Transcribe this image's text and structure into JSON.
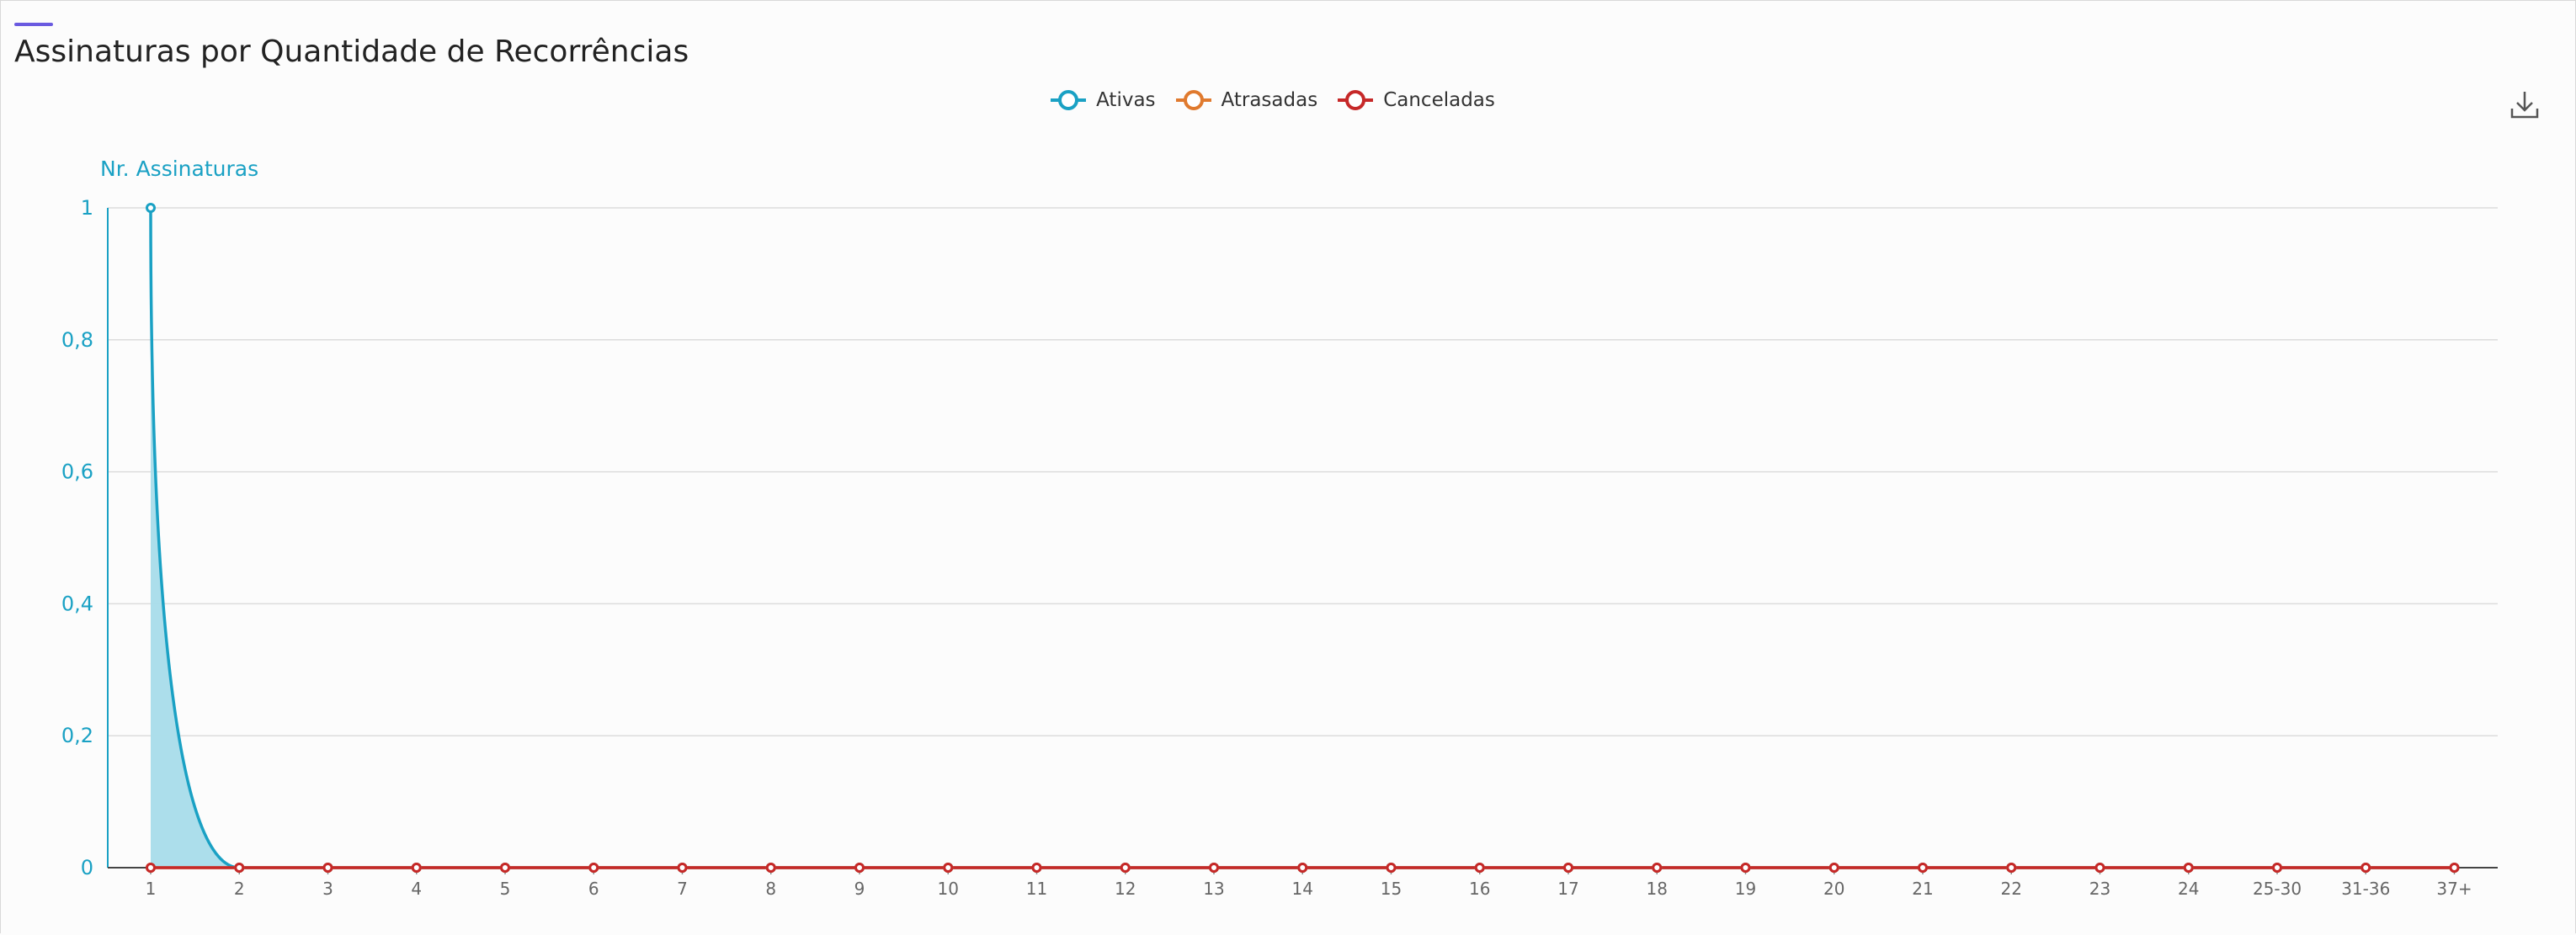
{
  "title": "Assinaturas por Quantidade de Recorrências",
  "legend": [
    {
      "label": "Ativas",
      "color": "#1aa1c4"
    },
    {
      "label": "Atrasadas",
      "color": "#e07a2e"
    },
    {
      "label": "Canceladas",
      "color": "#c62828"
    }
  ],
  "toolbar": {
    "download_icon": "download-icon"
  },
  "chart_data": {
    "type": "area",
    "title": "Assinaturas por Quantidade de Recorrências",
    "ylabel": "Nr. Assinaturas",
    "xlabel": "",
    "ylim": [
      0,
      1
    ],
    "y_ticks": [
      "0",
      "0,2",
      "0,4",
      "0,6",
      "0,8",
      "1"
    ],
    "grid": true,
    "legend_position": "top-center",
    "categories": [
      "1",
      "2",
      "3",
      "4",
      "5",
      "6",
      "7",
      "8",
      "9",
      "10",
      "11",
      "12",
      "13",
      "14",
      "15",
      "16",
      "17",
      "18",
      "19",
      "20",
      "21",
      "22",
      "23",
      "24",
      "25-30",
      "31-36",
      "37+"
    ],
    "series": [
      {
        "name": "Ativas",
        "color": "#1aa1c4",
        "fill": "#a8dcea",
        "values": [
          1,
          0,
          0,
          0,
          0,
          0,
          0,
          0,
          0,
          0,
          0,
          0,
          0,
          0,
          0,
          0,
          0,
          0,
          0,
          0,
          0,
          0,
          0,
          0,
          0,
          0,
          0
        ]
      },
      {
        "name": "Atrasadas",
        "color": "#e07a2e",
        "values": [
          0,
          0,
          0,
          0,
          0,
          0,
          0,
          0,
          0,
          0,
          0,
          0,
          0,
          0,
          0,
          0,
          0,
          0,
          0,
          0,
          0,
          0,
          0,
          0,
          0,
          0,
          0
        ]
      },
      {
        "name": "Canceladas",
        "color": "#c62828",
        "values": [
          0,
          0,
          0,
          0,
          0,
          0,
          0,
          0,
          0,
          0,
          0,
          0,
          0,
          0,
          0,
          0,
          0,
          0,
          0,
          0,
          0,
          0,
          0,
          0,
          0,
          0,
          0
        ]
      }
    ]
  }
}
